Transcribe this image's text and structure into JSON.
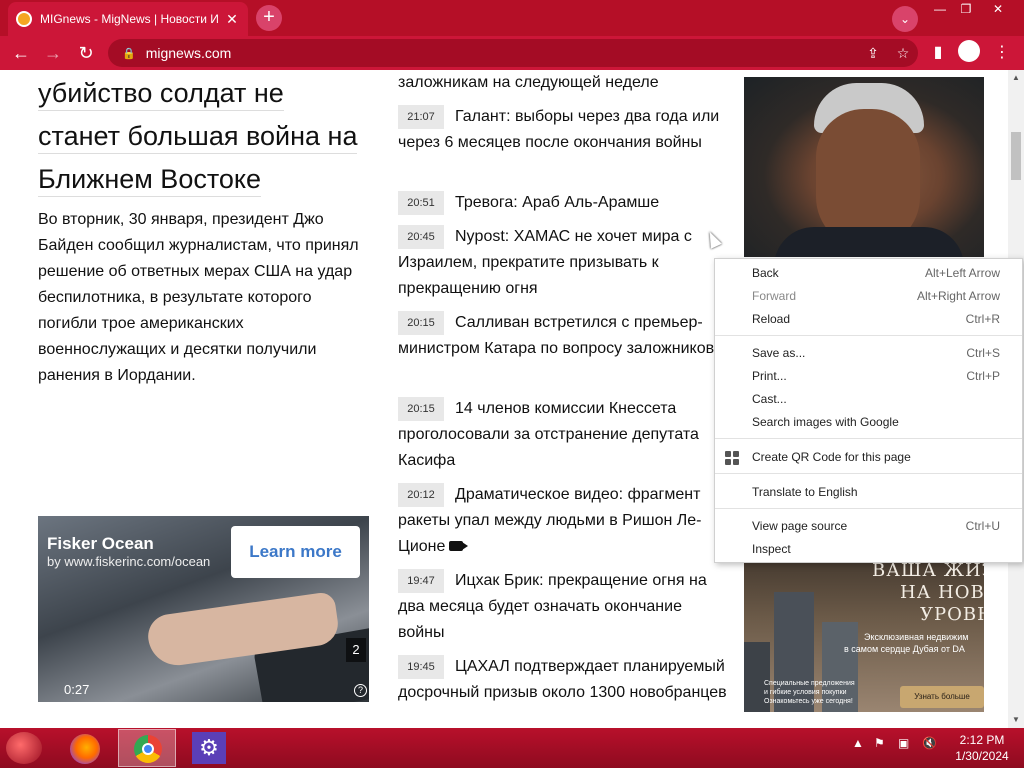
{
  "browser": {
    "tab_title": "MIGnews - MigNews | Новости Израиля",
    "tab_close": "✕",
    "new_tab": "+",
    "url": "mignews.com",
    "window_minimize": "—",
    "window_restore": "❐",
    "window_close": "✕"
  },
  "article": {
    "headline_lines": [
      "убийство солдат не",
      "станет большая война на",
      "Ближнем Востоке"
    ],
    "lede": "Во вторник, 30 января,  президент Джо Байден сообщил журналистам, что принял решение об ответных мерах США на удар беспилотника, в результате которого погибли трое американских военнослужащих и десятки получили ранения в Иордании."
  },
  "video_ad": {
    "title": "Fisker Ocean",
    "subtitle": "by www.fiskerinc.com/ocean",
    "cta": "Learn more",
    "count": "2",
    "time": "0:27",
    "help": "?"
  },
  "news": [
    {
      "time": "",
      "text": "заложникам на следующей неделе"
    },
    {
      "time": "21:07",
      "text": "Галант: выборы через два года или через 6 месяцев после окончания войны"
    },
    {
      "time": "20:51",
      "text": "Тревога: Араб Аль-Арамше"
    },
    {
      "time": "20:45",
      "text": "Nypost: ХАМАС не хочет мира с Израилем, прекратите призывать к прекращению огня"
    },
    {
      "time": "20:15",
      "text": "Салливан встретился с премьер-министром Катара по вопросу заложников"
    },
    {
      "time": "20:15",
      "text": "14 членов комиссии Кнессета проголосовали за отстранение депутата Касифа"
    },
    {
      "time": "20:12",
      "text": "Драматическое видео: фрагмент ракеты упал между людьми в Ришон Ле-Ционе"
    },
    {
      "time": "19:47",
      "text": "Ицхак Брик: прекращение огня на два месяца будет означать окончание войны"
    },
    {
      "time": "19:45",
      "text": "ЦАХАЛ подтверждает планируемый досрочный призыв около 1300 новобранцев"
    }
  ],
  "banner_ad": {
    "line1": "ВАША ЖИЗН",
    "line2": "НА НОВ",
    "line3": "УРОВН",
    "sub1": "Эксклюзивная недвижим",
    "sub2": "в самом сердце Дубая от DA",
    "fine1": "Специальные предложения",
    "fine2": "и гибкие условия покупки",
    "fine3": "Ознакомьтесь уже сегодня!",
    "button": "Узнать больше"
  },
  "context_menu": {
    "items": [
      {
        "label": "Back",
        "shortcut": "Alt+Left Arrow",
        "enabled": true
      },
      {
        "label": "Forward",
        "shortcut": "Alt+Right Arrow",
        "enabled": false
      },
      {
        "label": "Reload",
        "shortcut": "Ctrl+R",
        "enabled": true
      },
      {
        "label": "Save as...",
        "shortcut": "Ctrl+S",
        "enabled": true
      },
      {
        "label": "Print...",
        "shortcut": "Ctrl+P",
        "enabled": true
      },
      {
        "label": "Cast...",
        "shortcut": "",
        "enabled": true
      },
      {
        "label": "Search images with Google",
        "shortcut": "",
        "enabled": true
      },
      {
        "label": "Create QR Code for this page",
        "shortcut": "",
        "enabled": true
      },
      {
        "label": "Translate to English",
        "shortcut": "",
        "enabled": true
      },
      {
        "label": "View page source",
        "shortcut": "Ctrl+U",
        "enabled": true
      },
      {
        "label": "Inspect",
        "shortcut": "",
        "enabled": true
      }
    ]
  },
  "taskbar": {
    "time": "2:12 PM",
    "date": "1/30/2024"
  }
}
